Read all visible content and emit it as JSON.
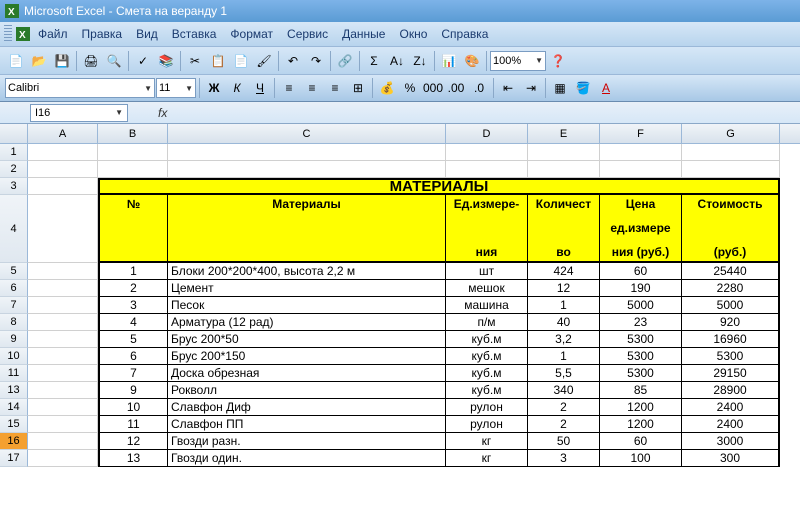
{
  "app": {
    "title": "Microsoft Excel - Смета на веранду 1"
  },
  "menu": {
    "file": "Файл",
    "edit": "Правка",
    "view": "Вид",
    "insert": "Вставка",
    "format": "Формат",
    "service": "Сервис",
    "data": "Данные",
    "window": "Окно",
    "help": "Справка"
  },
  "toolbar": {
    "font": "Calibri",
    "size": "11",
    "zoom": "100%",
    "bold": "Ж",
    "italic": "К",
    "underline": "Ч"
  },
  "namebox": {
    "cell": "I16",
    "fx": "fx"
  },
  "columns": [
    "A",
    "B",
    "C",
    "D",
    "E",
    "F",
    "G"
  ],
  "rownums": [
    "1",
    "2",
    "3",
    "4",
    "5",
    "6",
    "7",
    "8",
    "9",
    "10",
    "11",
    "13",
    "14",
    "15",
    "16",
    "17"
  ],
  "sheet": {
    "title": "МАТЕРИАЛЫ",
    "headers": {
      "num": "№",
      "material": "Материалы",
      "unit1": "Ед.измере-",
      "unit2": "ния",
      "qty1": "Количест",
      "qty2": "во",
      "price1": "Цена",
      "price2": "ед.измере",
      "price3": "ния (руб.)",
      "cost1": "Стоимость",
      "cost2": "(руб.)"
    },
    "rows": [
      {
        "n": "1",
        "m": "Блоки 200*200*400, высота 2,2 м",
        "u": "шт",
        "q": "424",
        "p": "60",
        "c": "25440"
      },
      {
        "n": "2",
        "m": "Цемент",
        "u": "мешок",
        "q": "12",
        "p": "190",
        "c": "2280"
      },
      {
        "n": "3",
        "m": "Песок",
        "u": "машина",
        "q": "1",
        "p": "5000",
        "c": "5000"
      },
      {
        "n": "4",
        "m": "Арматура (12 рад)",
        "u": "п/м",
        "q": "40",
        "p": "23",
        "c": "920"
      },
      {
        "n": "5",
        "m": "Брус 200*50",
        "u": "куб.м",
        "q": "3,2",
        "p": "5300",
        "c": "16960"
      },
      {
        "n": "6",
        "m": "Брус 200*150",
        "u": "куб.м",
        "q": "1",
        "p": "5300",
        "c": "5300"
      },
      {
        "n": "7",
        "m": "Доска обрезная",
        "u": "куб.м",
        "q": "5,5",
        "p": "5300",
        "c": "29150"
      },
      {
        "n": "9",
        "m": "Рокволл",
        "u": "куб.м",
        "q": "340",
        "p": "85",
        "c": "28900"
      },
      {
        "n": "10",
        "m": "Славфон Диф",
        "u": "рулон",
        "q": "2",
        "p": "1200",
        "c": "2400"
      },
      {
        "n": "11",
        "m": "Славфон ПП",
        "u": "рулон",
        "q": "2",
        "p": "1200",
        "c": "2400"
      },
      {
        "n": "12",
        "m": "Гвозди разн.",
        "u": "кг",
        "q": "50",
        "p": "60",
        "c": "3000"
      },
      {
        "n": "13",
        "m": "Гвозди один.",
        "u": "кг",
        "q": "3",
        "p": "100",
        "c": "300"
      }
    ]
  },
  "chart_data": {
    "type": "table",
    "title": "МАТЕРИАЛЫ",
    "columns": [
      "№",
      "Материалы",
      "Ед.измерения",
      "Количество",
      "Цена ед.измерения (руб.)",
      "Стоимость (руб.)"
    ],
    "rows": [
      [
        1,
        "Блоки 200*200*400, высота 2,2 м",
        "шт",
        424,
        60,
        25440
      ],
      [
        2,
        "Цемент",
        "мешок",
        12,
        190,
        2280
      ],
      [
        3,
        "Песок",
        "машина",
        1,
        5000,
        5000
      ],
      [
        4,
        "Арматура (12 рад)",
        "п/м",
        40,
        23,
        920
      ],
      [
        5,
        "Брус 200*50",
        "куб.м",
        3.2,
        5300,
        16960
      ],
      [
        6,
        "Брус 200*150",
        "куб.м",
        1,
        5300,
        5300
      ],
      [
        7,
        "Доска обрезная",
        "куб.м",
        5.5,
        5300,
        29150
      ],
      [
        9,
        "Рокволл",
        "куб.м",
        340,
        85,
        28900
      ],
      [
        10,
        "Славфон Диф",
        "рулон",
        2,
        1200,
        2400
      ],
      [
        11,
        "Славфон ПП",
        "рулон",
        2,
        1200,
        2400
      ],
      [
        12,
        "Гвозди разн.",
        "кг",
        50,
        60,
        3000
      ],
      [
        13,
        "Гвозди один.",
        "кг",
        3,
        100,
        300
      ]
    ]
  }
}
